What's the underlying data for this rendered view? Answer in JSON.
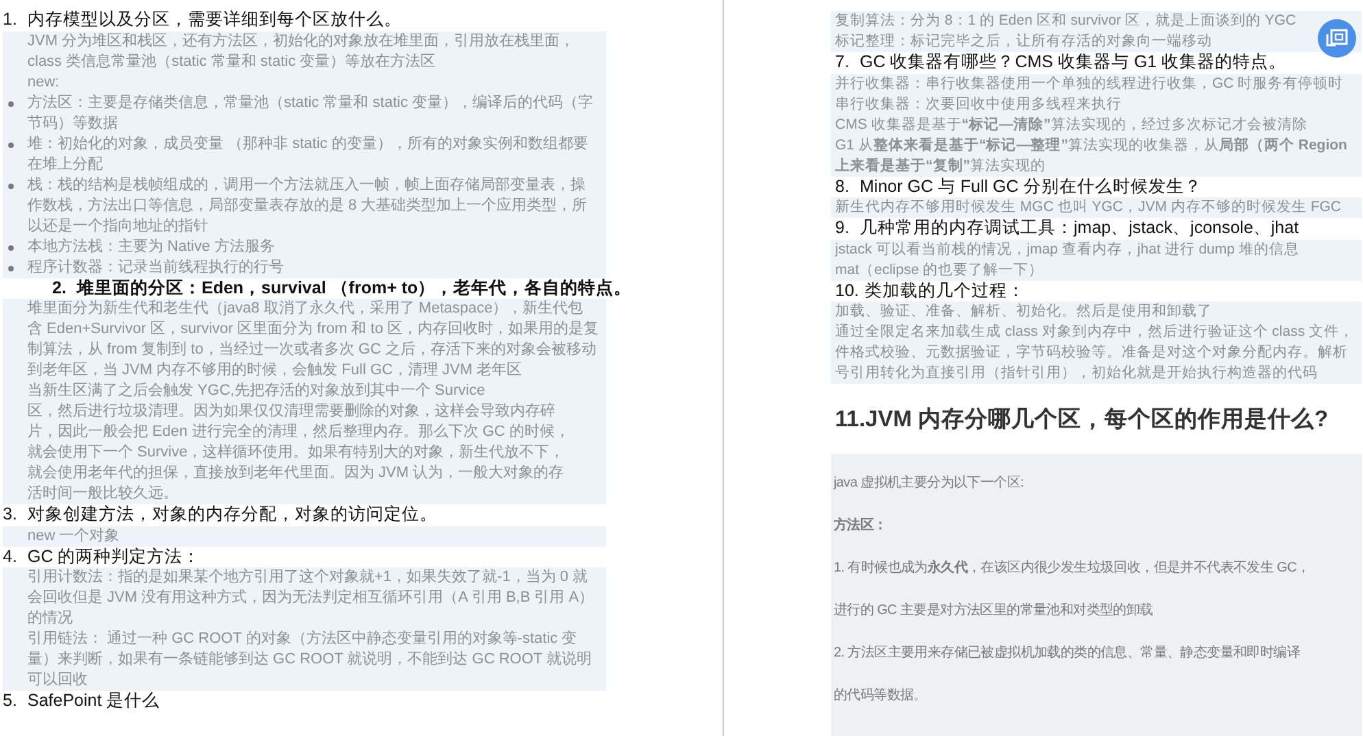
{
  "left_page": {
    "sections": [
      {
        "heading": {
          "kind": "plain",
          "number": "1.",
          "text": "内存模型以及分区，需要详细到每个区放什么。"
        },
        "items": [
          {
            "kind": "text",
            "lines": [
              "JVM 分为堆区和栈区，还有方法区，初始化的对象放在堆里面，引用放在栈里面，",
              "class 类信息常量池（static 常量和 static 变量）等放在方法区",
              "new:"
            ]
          },
          {
            "kind": "bullet",
            "lines": [
              "方法区：主要是存储类信息，常量池（static 常量和 static 变量），编译后的代码（字",
              "节码）等数据"
            ]
          },
          {
            "kind": "bullet",
            "lines": [
              "堆：初始化的对象，成员变量 （那种非 static 的变量），所有的对象实例和数组都要",
              "在堆上分配"
            ]
          },
          {
            "kind": "bullet",
            "lines": [
              "栈：栈的结构是栈帧组成的，调用一个方法就压入一帧，帧上面存储局部变量表，操",
              "作数栈，方法出口等信息，局部变量表存放的是 8 大基础类型加上一个应用类型，所",
              "以还是一个指向地址的指针"
            ]
          },
          {
            "kind": "bullet",
            "lines": [
              "本地方法栈：主要为 Native 方法服务"
            ]
          },
          {
            "kind": "bullet",
            "lines": [
              "程序计数器：记录当前线程执行的行号"
            ]
          }
        ]
      },
      {
        "heading": {
          "kind": "indented",
          "number": "2.",
          "text": "堆里面的分区：Eden，survival （from+ to），老年代，各自的特点。"
        },
        "items": [
          {
            "kind": "text",
            "lines": [
              "堆里面分为新生代和老生代（java8 取消了永久代，采用了 Metaspace），新生代包",
              "含 Eden+Survivor 区，survivor 区里面分为 from 和 to 区，内存回收时，如果用的是复",
              "制算法，从 from 复制到 to，当经过一次或者多次 GC 之后，存活下来的对象会被移动",
              "到老年区，当 JVM 内存不够用的时候，会触发 Full GC，清理 JVM 老年区",
              "当新生区满了之后会触发 YGC,先把存活的对象放到其中一个 Survice",
              "区，然后进行垃圾清理。因为如果仅仅清理需要删除的对象，这样会导致内存碎",
              "片，因此一般会把 Eden 进行完全的清理，然后整理内存。那么下次 GC 的时候，",
              "就会使用下一个 Survive，这样循环使用。如果有特别大的对象，新生代放不下，",
              "就会使用老年代的担保，直接放到老年代里面。因为 JVM 认为，一般大对象的存",
              "活时间一般比较久远。"
            ]
          }
        ]
      },
      {
        "heading": {
          "kind": "plain",
          "number": "3.",
          "text": "对象创建方法，对象的内存分配，对象的访问定位。"
        },
        "items": [
          {
            "kind": "text",
            "lines": [
              "new 一个对象"
            ]
          }
        ]
      },
      {
        "heading": {
          "kind": "plain",
          "number": "4.",
          "text": "GC 的两种判定方法："
        },
        "items": [
          {
            "kind": "text",
            "lines": [
              "引用计数法：指的是如果某个地方引用了这个对象就+1，如果失效了就-1，当为 0 就",
              "会回收但是 JVM 没有用这种方式，因为无法判定相互循环引用（A 引用 B,B 引用 A）",
              "的情况",
              "引用链法： 通过一种 GC ROOT 的对象（方法区中静态变量引用的对象等-static 变",
              "量）来判断，如果有一条链能够到达 GC ROOT 就说明，不能到达 GC ROOT 就说明",
              "可以回收"
            ]
          }
        ]
      },
      {
        "heading": {
          "kind": "plain",
          "number": "5.",
          "text": "SafePoint 是什么"
        }
      }
    ]
  },
  "right_page": {
    "sections": [
      {
        "items": [
          {
            "kind": "text",
            "lines": [
              "复制算法：分为 8：1 的 Eden 区和 survivor 区，就是上面谈到的 YGC",
              "标记整理：标记完毕之后，让所有存活的对象向一端移动"
            ]
          }
        ]
      },
      {
        "heading": {
          "kind": "plain",
          "number": "7.",
          "text": "GC 收集器有哪些？CMS 收集器与 G1 收集器的特点。"
        },
        "items": [
          {
            "kind": "text",
            "lines": [
              "并行收集器：串行收集器使用一个单独的线程进行收集，GC 时服务有停顿时",
              "串行收集器：次要回收中使用多线程来执行",
              "CMS 收集器是基于**“标记—清除”**算法实现的，经过多次标记才会被清除",
              "G1 从**整体来看是基于“标记—整理”**算法实现的收集器，从**局部（两个 Region**",
              "**上来看是基于“复制”**算法实现的"
            ]
          }
        ]
      },
      {
        "heading": {
          "kind": "plain",
          "number": "8.",
          "text": "Minor GC 与 Full GC 分别在什么时候发生？"
        },
        "items": [
          {
            "kind": "text",
            "lines": [
              "新生代内存不够用时候发生 MGC 也叫 YGC，JVM 内存不够的时候发生 FGC"
            ]
          }
        ]
      },
      {
        "heading": {
          "kind": "plain",
          "number": "9.",
          "text": "几种常用的内存调试工具：jmap、jstack、jconsole、jhat"
        },
        "items": [
          {
            "kind": "text",
            "lines": [
              "jstack 可以看当前栈的情况，jmap 查看内存，jhat 进行 dump 堆的信息",
              "mat（eclipse 的也要了解一下）"
            ]
          }
        ]
      },
      {
        "heading": {
          "kind": "tight",
          "number": "10.",
          "text": "类加载的几个过程："
        },
        "items": [
          {
            "kind": "text",
            "lines": [
              "加载、验证、准备、解析、初始化。然后是使用和卸载了",
              "通过全限定名来加载生成 class 对象到内存中，然后进行验证这个 class 文件，",
              "件格式校验、元数据验证，字节码校验等。准备是对这个对象分配内存。解析",
              "号引用转化为直接引用（指针引用），初始化就是开始执行构造器的代码"
            ]
          }
        ]
      }
    ],
    "article": {
      "title": "11.JVM 内存分哪几个区，每个区的作用是什么?",
      "lines": [
        "java 虚拟机主要分为以下一个区:",
        "**方法区：**",
        "1. 有时候也成为**永久代**，在该区内很少发生垃圾回收，但是并不代表不发生 GC，",
        "进行的 GC 主要是对方法区里的常量池和对类型的卸载",
        "2. 方法区主要用来存储已被虚拟机加载的类的信息、常量、静态变量和即时编译",
        "的代码等数据。"
      ]
    }
  }
}
